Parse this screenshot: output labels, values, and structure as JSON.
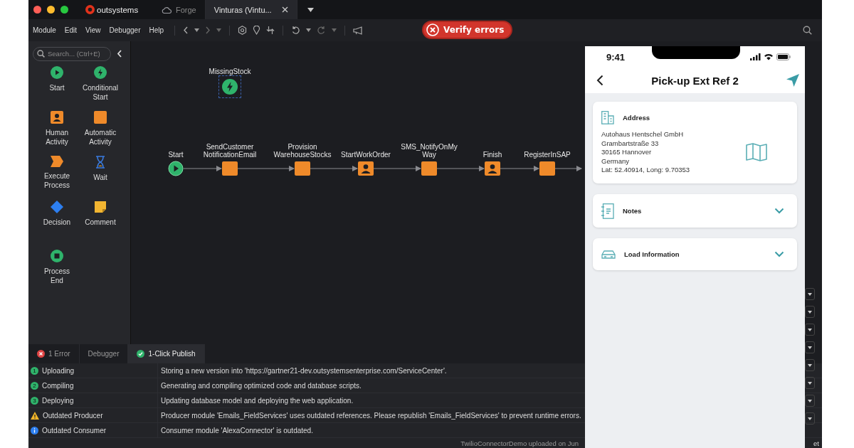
{
  "title_bar": {
    "brand": "outsystems",
    "tabs": [
      {
        "label": "Forge",
        "kind": "cloud",
        "selected": false
      },
      {
        "label": "Vinturas (Vintu...",
        "kind": "module",
        "selected": true
      }
    ]
  },
  "menu": [
    "Module",
    "Edit",
    "View",
    "Debugger",
    "Help"
  ],
  "verify_button": {
    "label": "Verify errors"
  },
  "toolbox": {
    "search": {
      "placeholder": "Search... (Ctrl+E)"
    },
    "items": [
      {
        "kind": "start",
        "label": "Start"
      },
      {
        "kind": "conditional",
        "label": "Conditional Start"
      },
      {
        "kind": "human",
        "label": "Human Activity"
      },
      {
        "kind": "automatic",
        "label": "Automatic Activity"
      },
      {
        "kind": "execute",
        "label": "Execute Process"
      },
      {
        "kind": "wait",
        "label": "Wait"
      },
      {
        "kind": "decision",
        "label": "Decision"
      },
      {
        "kind": "comment",
        "label": "Comment"
      },
      {
        "kind": "end",
        "label": "Process End"
      }
    ]
  },
  "canvas": {
    "floating_node": {
      "kind": "conditional",
      "label": "MissingStock",
      "selected": true
    },
    "flow": [
      {
        "kind": "start",
        "label": "Start"
      },
      {
        "kind": "automatic",
        "label": "SendCustomer NotificationEmail"
      },
      {
        "kind": "automatic",
        "label": "Provision WarehouseStocks"
      },
      {
        "kind": "human",
        "label": "StartWorkOrder"
      },
      {
        "kind": "automatic",
        "label": "SMS_NotifyOnMy Way"
      },
      {
        "kind": "human",
        "label": "Finish"
      },
      {
        "kind": "automatic",
        "label": "RegisterInSAP"
      }
    ]
  },
  "bottom_panel": {
    "tabs": [
      {
        "label": "1 Error",
        "kind": "error",
        "selected": false
      },
      {
        "label": "Debugger",
        "kind": "plain",
        "selected": false
      },
      {
        "label": "1-Click Publish",
        "kind": "ok",
        "selected": true
      }
    ],
    "rows": [
      {
        "kind": "step",
        "badge": "1",
        "name": "Uploading",
        "message": "Storing a new version into 'https://gartner21-dev.outsystemsenterprise.com/ServiceCenter'."
      },
      {
        "kind": "step",
        "badge": "2",
        "name": "Compiling",
        "message": "Generating and compiling optimized code and database scripts."
      },
      {
        "kind": "step",
        "badge": "3",
        "name": "Deploying",
        "message": "Updating database model and deploying the web application."
      },
      {
        "kind": "warning",
        "name": "Outdated Producer",
        "message": "Producer module 'Emails_FieldServices' uses outdated references. Please republish 'Emails_FieldServices' to prevent runtime errors."
      },
      {
        "kind": "info",
        "name": "Outdated Consumer",
        "message": "Consumer module 'AlexaConnector' is outdated."
      }
    ],
    "status": "TwilioConnectorDemo uploaded on Jun",
    "status_right": "et"
  },
  "phone": {
    "time": "9:41",
    "title": "Pick-up Ext Ref 2",
    "cards": [
      {
        "kind": "address",
        "title": "Address",
        "lines": [
          "Autohaus Hentschel GmbH",
          "Grambartstraße 33",
          "30165 Hannover",
          "Germany",
          "Lat: 52.40914, Long: 9.70353"
        ]
      },
      {
        "kind": "notes",
        "title": "Notes",
        "expanded": false
      },
      {
        "kind": "load",
        "title": "Load Information",
        "expanded": false
      }
    ]
  }
}
